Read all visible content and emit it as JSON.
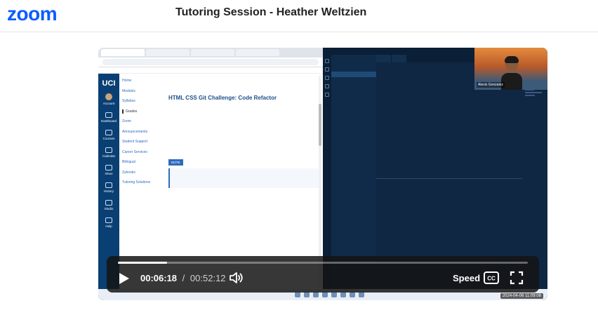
{
  "header": {
    "logo": "zoom",
    "title": "Tutoring Session - Heather Weltzien",
    "brand_color": "#0b5cff"
  },
  "player": {
    "current_time": "00:06:18",
    "separator": "/",
    "duration": "00:52:12",
    "progress_fraction": 0.12,
    "speed_label": "Speed",
    "cc_label": "CC",
    "timestamp_overlay": "2024-04-06 11:09:08",
    "icons": {
      "play": "play-icon",
      "volume": "volume-icon",
      "cc": "closed-captions-icon",
      "fullscreen": "fullscreen-icon"
    }
  },
  "recording": {
    "browser": {
      "uci_logo": "UCI",
      "side_nav": [
        "Account",
        "Dashboard",
        "Courses",
        "Calendar",
        "Inbox",
        "History",
        "Studio",
        "Help"
      ],
      "course_nav": [
        "Home",
        "Modules",
        "Syllabus",
        "Grades",
        "Zoom",
        "Announcements",
        "Student Support",
        "Career Services",
        "Bilingual",
        "Zybooks",
        "Tutoring Solutions"
      ],
      "course_nav_active": "Grades",
      "heading": "HTML CSS Git Challenge: Code Refactor",
      "note_badge": "NOTE"
    },
    "webcam": {
      "name": "Alexis Gonzalez"
    }
  }
}
